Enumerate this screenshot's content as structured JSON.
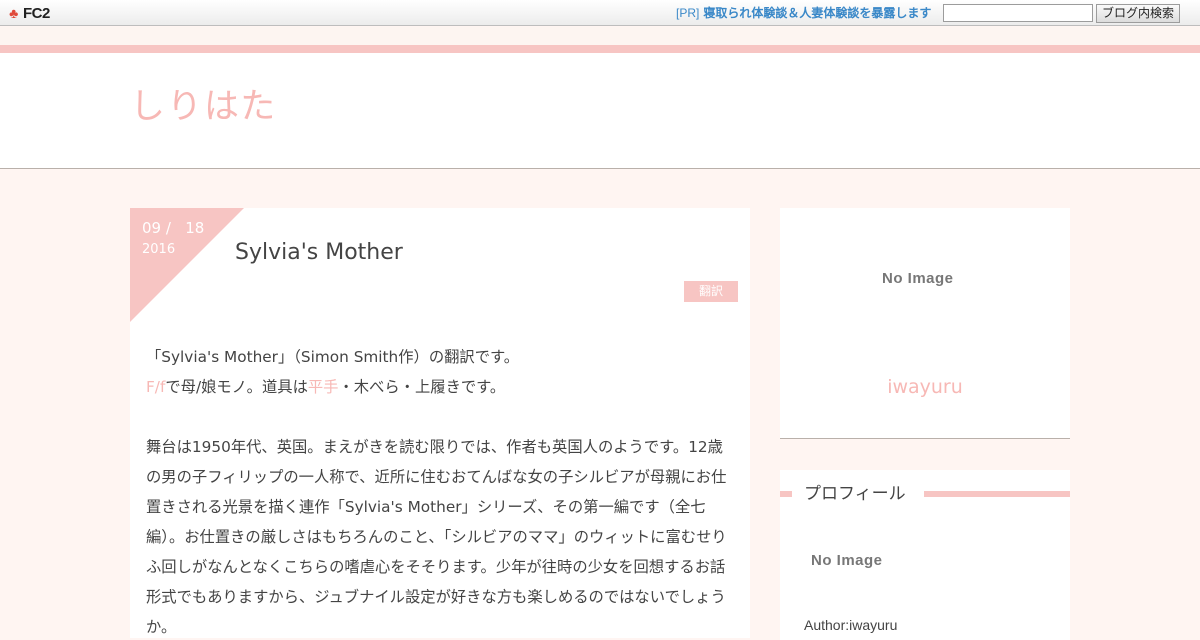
{
  "topbar": {
    "logo_text": "FC2",
    "pr_tag": "[PR]",
    "pr_link": "寝取られ体験談＆人妻体験談を暴露します",
    "search_value": "",
    "search_button": "ブログ内検索"
  },
  "header": {
    "site_title": "しりはた"
  },
  "post": {
    "date_md": "09 /   18",
    "date_year": "2016",
    "title": "Sylvia's Mother",
    "category": "翻訳",
    "para1_line1": "「Sylvia's Mother」（Simon Smith作）の翻訳です。",
    "para1_tag1": "F/f",
    "para1_mid1": "で母/娘モノ。道具は",
    "para1_tag2": "平手",
    "para1_mid2": "・木べら・上履きです。",
    "para2": "舞台は1950年代、英国。まえがきを読む限りでは、作者も英国人のようです。12歳の男の子フィリップの一人称で、近所に住むおてんばな女の子シルビアが母親にお仕置きされる光景を描く連作「Sylvia's Mother」シリーズ、その第一編です（全七編）。お仕置きの厳しさはもちろんのこと、「シルビアのママ」のウィットに富むせりふ回しがなんとなくこちらの嗜虐心をそそります。少年が往時の少女を回想するお話形式でもありますから、ジュブナイル設定が好きな方も楽しめるのではないでしょうか。"
  },
  "sidebar": {
    "top_image_alt": "No Image",
    "top_author": "iwayuru",
    "profile_heading": "プロフィール",
    "profile_image_alt": "No Image",
    "profile_author": "Author:iwayuru"
  },
  "colors": {
    "accent_pink": "#f7c5c3",
    "title_pink": "#f7b8b5",
    "link_blue": "#3a88c8",
    "background": "#fff5f2"
  }
}
